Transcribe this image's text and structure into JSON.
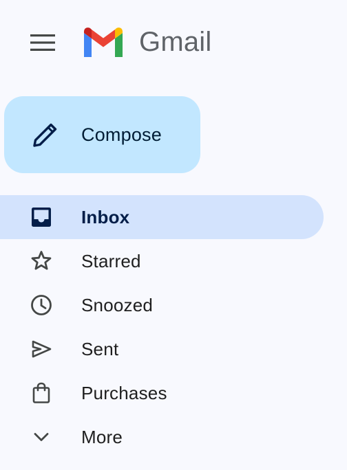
{
  "app": {
    "product_name": "Gmail",
    "logo_icon": "gmail-m-logo",
    "menu_icon": "hamburger-menu-icon"
  },
  "compose": {
    "label": "Compose",
    "icon": "pencil-icon",
    "background": "#c2e7ff"
  },
  "nav": {
    "active_background": "#d3e3fd",
    "items": [
      {
        "label": "Inbox",
        "icon": "inbox-icon",
        "active": true
      },
      {
        "label": "Starred",
        "icon": "star-icon",
        "active": false
      },
      {
        "label": "Snoozed",
        "icon": "clock-icon",
        "active": false
      },
      {
        "label": "Sent",
        "icon": "send-icon",
        "active": false
      },
      {
        "label": "Purchases",
        "icon": "shopping-bag-icon",
        "active": false
      },
      {
        "label": "More",
        "icon": "chevron-down-icon",
        "active": false
      }
    ]
  }
}
